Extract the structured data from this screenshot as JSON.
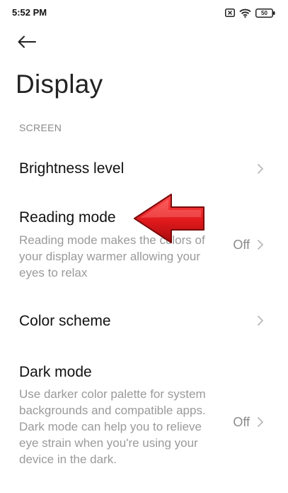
{
  "status_bar": {
    "time": "5:52 PM",
    "battery": "50",
    "icons": [
      "sim-x-icon",
      "wifi-icon",
      "battery-icon"
    ]
  },
  "header": {
    "back_icon": "back-arrow-icon",
    "title": "Display"
  },
  "section": {
    "label": "SCREEN"
  },
  "settings": [
    {
      "title": "Brightness level",
      "description": "",
      "value": ""
    },
    {
      "title": "Reading mode",
      "description": "Reading mode makes the colors of your display warmer allowing your eyes to relax",
      "value": "Off"
    },
    {
      "title": "Color scheme",
      "description": "",
      "value": ""
    },
    {
      "title": "Dark mode",
      "description": "Use darker color palette for system backgrounds and compatible apps. Dark mode can help you to relieve eye strain when you're using your device in the dark.",
      "value": "Off"
    }
  ],
  "annotation": {
    "icon": "red-arrow-icon",
    "color": "#e0191c"
  },
  "colors": {
    "text": "#111111",
    "secondary": "#9a9a9a",
    "background": "#ffffff"
  }
}
